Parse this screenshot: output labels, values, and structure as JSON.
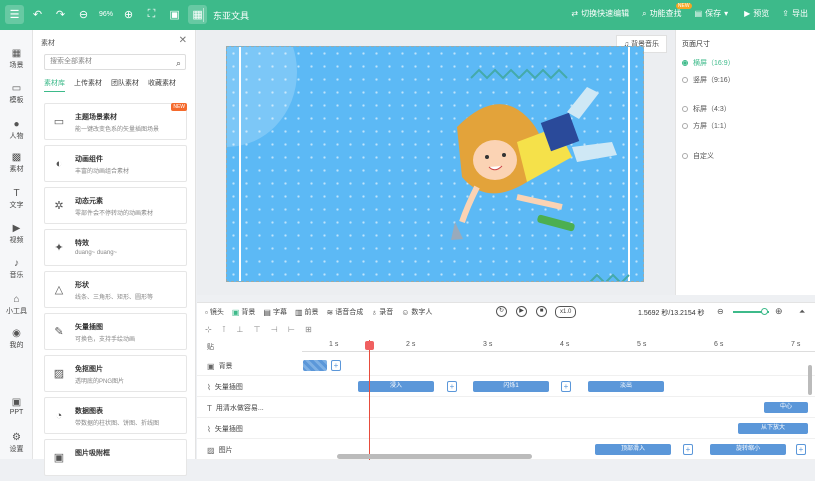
{
  "topbar": {
    "undo_icon": "undo-icon",
    "redo_icon": "redo-icon",
    "zoom_value": "96%",
    "doc_title": "东亚文具",
    "actions": [
      {
        "label": "切换快速编辑",
        "icon": "switch-icon"
      },
      {
        "label": "功能查找",
        "icon": "search-function-icon",
        "badge": "NEW"
      },
      {
        "label": "保存",
        "icon": "save-icon"
      },
      {
        "label": "预览",
        "icon": "preview-icon"
      },
      {
        "label": "导出",
        "icon": "export-icon"
      }
    ]
  },
  "leftnav": [
    {
      "label": "场景",
      "icon": "scene-icon"
    },
    {
      "label": "模板",
      "icon": "template-icon"
    },
    {
      "label": "人物",
      "icon": "person-icon"
    },
    {
      "label": "素材",
      "icon": "material-icon"
    },
    {
      "label": "文字",
      "icon": "text-icon"
    },
    {
      "label": "视频",
      "icon": "video-icon"
    },
    {
      "label": "音乐",
      "icon": "music-icon"
    },
    {
      "label": "小工具",
      "icon": "tools-icon"
    },
    {
      "label": "我的",
      "icon": "my-icon"
    },
    {
      "label": "PPT",
      "icon": "ppt-icon"
    },
    {
      "label": "设置",
      "icon": "settings-icon"
    }
  ],
  "panel": {
    "title": "素材",
    "search_placeholder": "搜索全部素材",
    "tabs": [
      "素材库",
      "上传素材",
      "团队素材",
      "收藏素材"
    ],
    "cards": [
      {
        "title": "主题场景素材",
        "desc": "能一键改变色系的矢量插图场景",
        "badge": "NEW",
        "icon": "theme-scene-icon"
      },
      {
        "title": "动画组件",
        "desc": "丰富的动画组合素材",
        "icon": "animation-component-icon"
      },
      {
        "title": "动态元素",
        "desc": "零部件会不停转动的动画素材",
        "icon": "dynamic-element-icon"
      },
      {
        "title": "特效",
        "desc": "duang~ duang~",
        "icon": "effect-icon"
      },
      {
        "title": "形状",
        "desc": "线条、三角形、矩形、圆形等",
        "icon": "shape-icon"
      },
      {
        "title": "矢量插图",
        "desc": "可换色，支持手绘动画",
        "icon": "vector-illustration-icon"
      },
      {
        "title": "免抠图片",
        "desc": "透明底的PNG图片",
        "icon": "cutout-image-icon"
      },
      {
        "title": "数据图表",
        "desc": "带数据的柱状图、饼图、折线图",
        "icon": "data-chart-icon"
      },
      {
        "title": "图片吸附框",
        "desc": "",
        "icon": "image-frame-icon"
      }
    ]
  },
  "canvas": {
    "bgm_label": "背景音乐",
    "scene_color": "#5cb9f5"
  },
  "props": {
    "title": "页面尺寸",
    "options": [
      {
        "label": "横屏（16:9）",
        "selected": true
      },
      {
        "label": "竖屏（9:16）",
        "selected": false
      },
      {
        "label": "标屏（4:3）",
        "selected": false
      },
      {
        "label": "方屏（1:1）",
        "selected": false
      },
      {
        "label": "自定义",
        "selected": false
      }
    ]
  },
  "timeline": {
    "tools": [
      {
        "label": "镜头",
        "icon": "camera-icon"
      },
      {
        "label": "背景",
        "icon": "background-icon",
        "active": true
      },
      {
        "label": "字幕",
        "icon": "subtitle-icon"
      },
      {
        "label": "前景",
        "icon": "foreground-icon"
      },
      {
        "label": "语音合成",
        "icon": "voice-synthesis-icon"
      },
      {
        "label": "录音",
        "icon": "record-icon"
      },
      {
        "label": "数字人",
        "icon": "digital-human-icon"
      }
    ],
    "speed": "x1.0",
    "time_info": "1.5692 秒/13.2154 秒",
    "ruler_label": "贴",
    "ticks": [
      "1 s",
      "2 s",
      "3 s",
      "4 s",
      "5 s",
      "6 s",
      "7 s"
    ],
    "tracks": [
      {
        "name": "背景",
        "icon": "background-track-icon",
        "clips": []
      },
      {
        "name": "矢量插图",
        "icon": "vector-track-icon",
        "clips": [
          "浸入",
          "闪烁1",
          "淡出"
        ]
      },
      {
        "name": "用清水做容易...",
        "icon": "text-track-icon",
        "clips": [
          "中心"
        ]
      },
      {
        "name": "矢量插图",
        "icon": "vector-track-icon",
        "clips": [
          "从下放大"
        ]
      },
      {
        "name": "图片",
        "icon": "image-track-icon",
        "clips": [
          "顶部滑入",
          "旋转缩小"
        ]
      }
    ]
  }
}
